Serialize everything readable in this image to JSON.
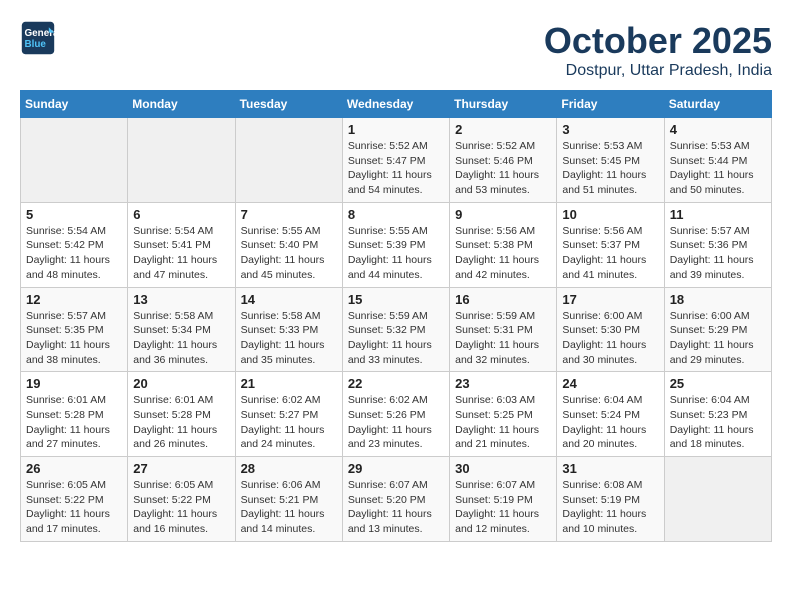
{
  "logo": {
    "line1": "General",
    "line2": "Blue"
  },
  "title": "October 2025",
  "location": "Dostpur, Uttar Pradesh, India",
  "weekdays": [
    "Sunday",
    "Monday",
    "Tuesday",
    "Wednesday",
    "Thursday",
    "Friday",
    "Saturday"
  ],
  "weeks": [
    [
      {
        "day": "",
        "info": ""
      },
      {
        "day": "",
        "info": ""
      },
      {
        "day": "",
        "info": ""
      },
      {
        "day": "1",
        "info": "Sunrise: 5:52 AM\nSunset: 5:47 PM\nDaylight: 11 hours\nand 54 minutes."
      },
      {
        "day": "2",
        "info": "Sunrise: 5:52 AM\nSunset: 5:46 PM\nDaylight: 11 hours\nand 53 minutes."
      },
      {
        "day": "3",
        "info": "Sunrise: 5:53 AM\nSunset: 5:45 PM\nDaylight: 11 hours\nand 51 minutes."
      },
      {
        "day": "4",
        "info": "Sunrise: 5:53 AM\nSunset: 5:44 PM\nDaylight: 11 hours\nand 50 minutes."
      }
    ],
    [
      {
        "day": "5",
        "info": "Sunrise: 5:54 AM\nSunset: 5:42 PM\nDaylight: 11 hours\nand 48 minutes."
      },
      {
        "day": "6",
        "info": "Sunrise: 5:54 AM\nSunset: 5:41 PM\nDaylight: 11 hours\nand 47 minutes."
      },
      {
        "day": "7",
        "info": "Sunrise: 5:55 AM\nSunset: 5:40 PM\nDaylight: 11 hours\nand 45 minutes."
      },
      {
        "day": "8",
        "info": "Sunrise: 5:55 AM\nSunset: 5:39 PM\nDaylight: 11 hours\nand 44 minutes."
      },
      {
        "day": "9",
        "info": "Sunrise: 5:56 AM\nSunset: 5:38 PM\nDaylight: 11 hours\nand 42 minutes."
      },
      {
        "day": "10",
        "info": "Sunrise: 5:56 AM\nSunset: 5:37 PM\nDaylight: 11 hours\nand 41 minutes."
      },
      {
        "day": "11",
        "info": "Sunrise: 5:57 AM\nSunset: 5:36 PM\nDaylight: 11 hours\nand 39 minutes."
      }
    ],
    [
      {
        "day": "12",
        "info": "Sunrise: 5:57 AM\nSunset: 5:35 PM\nDaylight: 11 hours\nand 38 minutes."
      },
      {
        "day": "13",
        "info": "Sunrise: 5:58 AM\nSunset: 5:34 PM\nDaylight: 11 hours\nand 36 minutes."
      },
      {
        "day": "14",
        "info": "Sunrise: 5:58 AM\nSunset: 5:33 PM\nDaylight: 11 hours\nand 35 minutes."
      },
      {
        "day": "15",
        "info": "Sunrise: 5:59 AM\nSunset: 5:32 PM\nDaylight: 11 hours\nand 33 minutes."
      },
      {
        "day": "16",
        "info": "Sunrise: 5:59 AM\nSunset: 5:31 PM\nDaylight: 11 hours\nand 32 minutes."
      },
      {
        "day": "17",
        "info": "Sunrise: 6:00 AM\nSunset: 5:30 PM\nDaylight: 11 hours\nand 30 minutes."
      },
      {
        "day": "18",
        "info": "Sunrise: 6:00 AM\nSunset: 5:29 PM\nDaylight: 11 hours\nand 29 minutes."
      }
    ],
    [
      {
        "day": "19",
        "info": "Sunrise: 6:01 AM\nSunset: 5:28 PM\nDaylight: 11 hours\nand 27 minutes."
      },
      {
        "day": "20",
        "info": "Sunrise: 6:01 AM\nSunset: 5:28 PM\nDaylight: 11 hours\nand 26 minutes."
      },
      {
        "day": "21",
        "info": "Sunrise: 6:02 AM\nSunset: 5:27 PM\nDaylight: 11 hours\nand 24 minutes."
      },
      {
        "day": "22",
        "info": "Sunrise: 6:02 AM\nSunset: 5:26 PM\nDaylight: 11 hours\nand 23 minutes."
      },
      {
        "day": "23",
        "info": "Sunrise: 6:03 AM\nSunset: 5:25 PM\nDaylight: 11 hours\nand 21 minutes."
      },
      {
        "day": "24",
        "info": "Sunrise: 6:04 AM\nSunset: 5:24 PM\nDaylight: 11 hours\nand 20 minutes."
      },
      {
        "day": "25",
        "info": "Sunrise: 6:04 AM\nSunset: 5:23 PM\nDaylight: 11 hours\nand 18 minutes."
      }
    ],
    [
      {
        "day": "26",
        "info": "Sunrise: 6:05 AM\nSunset: 5:22 PM\nDaylight: 11 hours\nand 17 minutes."
      },
      {
        "day": "27",
        "info": "Sunrise: 6:05 AM\nSunset: 5:22 PM\nDaylight: 11 hours\nand 16 minutes."
      },
      {
        "day": "28",
        "info": "Sunrise: 6:06 AM\nSunset: 5:21 PM\nDaylight: 11 hours\nand 14 minutes."
      },
      {
        "day": "29",
        "info": "Sunrise: 6:07 AM\nSunset: 5:20 PM\nDaylight: 11 hours\nand 13 minutes."
      },
      {
        "day": "30",
        "info": "Sunrise: 6:07 AM\nSunset: 5:19 PM\nDaylight: 11 hours\nand 12 minutes."
      },
      {
        "day": "31",
        "info": "Sunrise: 6:08 AM\nSunset: 5:19 PM\nDaylight: 11 hours\nand 10 minutes."
      },
      {
        "day": "",
        "info": ""
      }
    ]
  ]
}
